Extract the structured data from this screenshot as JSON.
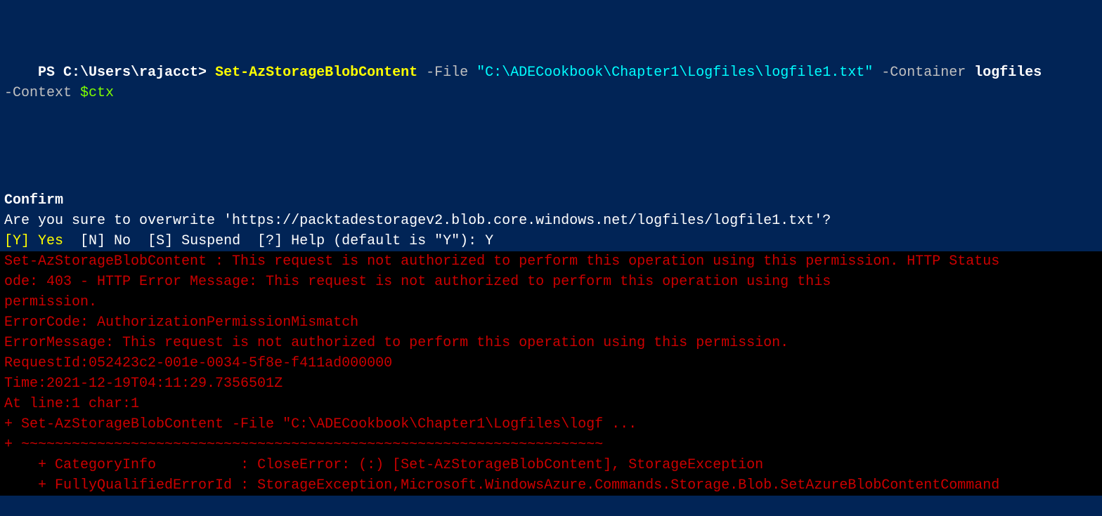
{
  "command": {
    "prompt": "PS C:\\Users\\rajacct> ",
    "cmdlet": "Set-AzStorageBlobContent",
    "fileParam": " -File ",
    "filePath": "\"C:\\ADECookbook\\Chapter1\\Logfiles\\logfile1.txt\"",
    "containerParam": " -Container ",
    "containerValue": "logfiles",
    "contextParam": "-Context ",
    "contextVar": "$ctx"
  },
  "confirm": {
    "title": "Confirm",
    "question": "Are you sure to overwrite 'https://packtadestoragev2.blob.core.windows.net/logfiles/logfile1.txt'?",
    "yesKey": "[Y]",
    "yesLabel": " Yes  ",
    "noKey": "[N]",
    "noLabel": " No  ",
    "suspendKey": "[S]",
    "suspendLabel": " Suspend  ",
    "helpKey": "[?]",
    "helpLabel": " Help (default is \"Y\"): Y"
  },
  "error": {
    "line1": "Set-AzStorageBlobContent : This request is not authorized to perform this operation using this permission. HTTP Status",
    "line2": "ode: 403 - HTTP Error Message: This request is not authorized to perform this operation using this",
    "line3": "permission.",
    "line4": "ErrorCode: AuthorizationPermissionMismatch",
    "line5": "ErrorMessage: This request is not authorized to perform this operation using this permission.",
    "line6": "RequestId:052423c2-001e-0034-5f8e-f411ad000000",
    "line7": "Time:2021-12-19T04:11:29.7356501Z",
    "line8": "At line:1 char:1",
    "line9": "+ Set-AzStorageBlobContent -File \"C:\\ADECookbook\\Chapter1\\Logfiles\\logf ...",
    "line10": "+ ~~~~~~~~~~~~~~~~~~~~~~~~~~~~~~~~~~~~~~~~~~~~~~~~~~~~~~~~~~~~~~~~~~~~~",
    "line11": "    + CategoryInfo          : CloseError: (:) [Set-AzStorageBlobContent], StorageException",
    "line12": "    + FullyQualifiedErrorId : StorageException,Microsoft.WindowsAzure.Commands.Storage.Blob.SetAzureBlobContentCommand"
  }
}
